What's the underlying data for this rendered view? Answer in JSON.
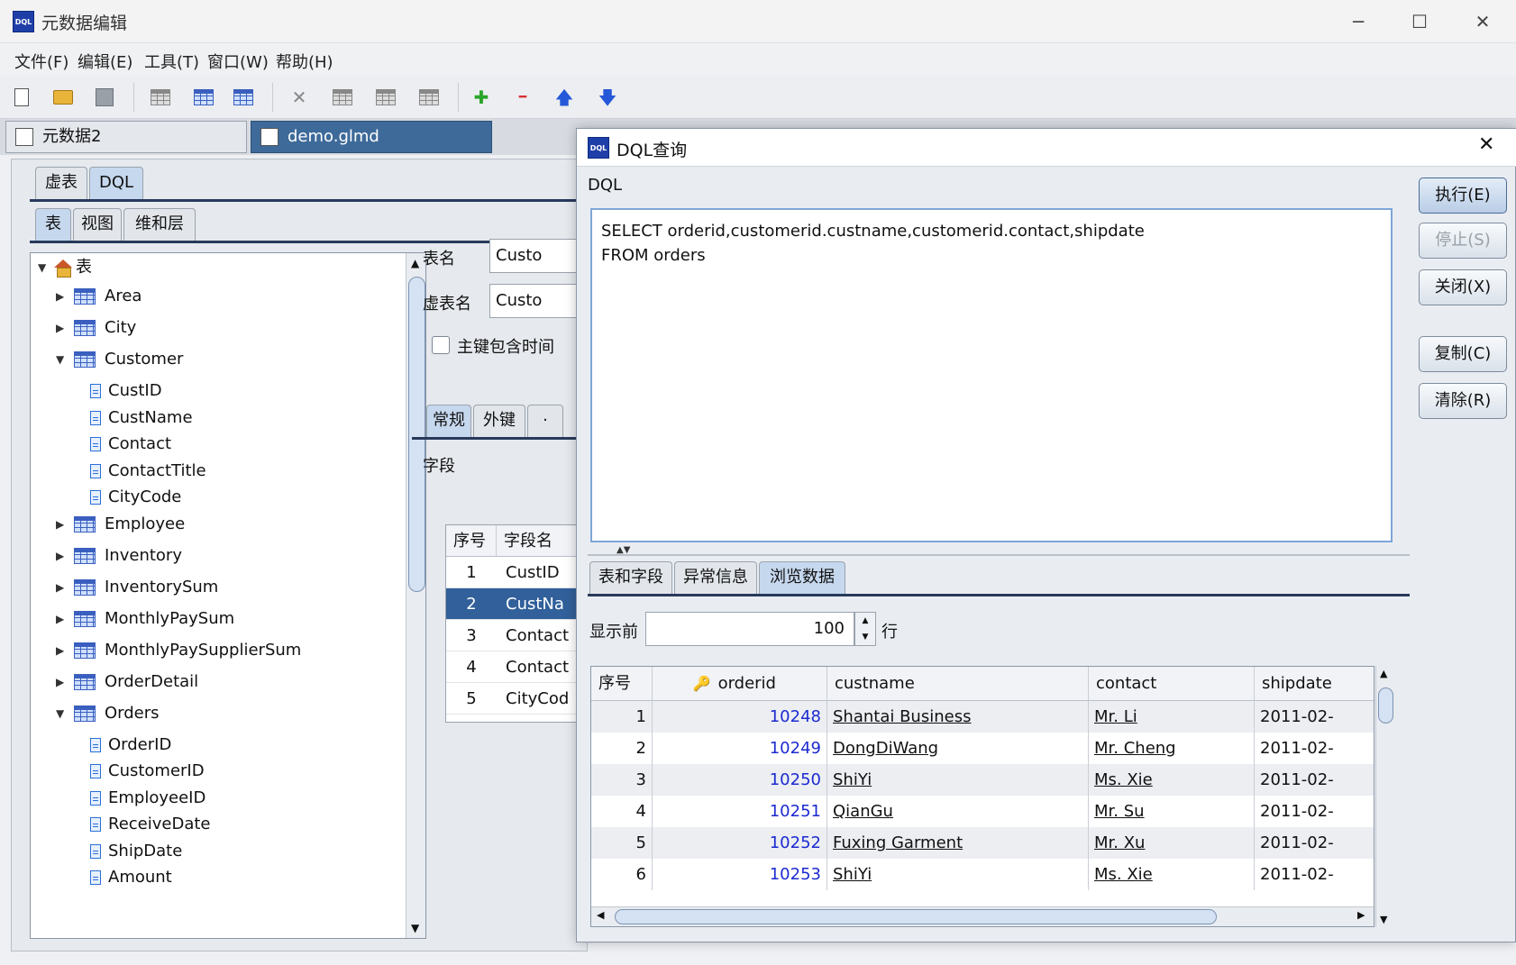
{
  "window": {
    "title": "元数据编辑",
    "app_icon": "DQL",
    "controls": {
      "minimize": "─",
      "maximize": "☐",
      "close": "✕"
    }
  },
  "menu": [
    "文件(F)",
    "编辑(E)",
    "工具(T)",
    "窗口(W)",
    "帮助(H)"
  ],
  "toolbar_icons": [
    "new-icon",
    "open-folder-icon",
    "save-icon",
    "table-icon",
    "add-table-icon",
    "add-table-2-icon",
    "delete-icon",
    "copy-icon",
    "table-gray-icon",
    "table-gray-2-icon",
    "add-icon",
    "remove-icon",
    "move-up-icon",
    "move-down-icon"
  ],
  "toolbar_glyphs": {
    "delete": "✕",
    "add": "✚",
    "remove": "━",
    "up": "🡅",
    "down": "🡇"
  },
  "doc_tabs": [
    "元数据2",
    "demo.glmd"
  ],
  "editor": {
    "top_tabs": [
      "虚表",
      "DQL"
    ],
    "sub_tabs": [
      "表",
      "视图",
      "维和层"
    ],
    "tree_root": "表",
    "tree": [
      {
        "kind": "table",
        "label": "Area",
        "expanded": false
      },
      {
        "kind": "table",
        "label": "City",
        "expanded": false
      },
      {
        "kind": "table",
        "label": "Customer",
        "expanded": true
      },
      {
        "kind": "field",
        "label": "CustID"
      },
      {
        "kind": "field",
        "label": "CustName"
      },
      {
        "kind": "field",
        "label": "Contact"
      },
      {
        "kind": "field",
        "label": "ContactTitle"
      },
      {
        "kind": "field",
        "label": "CityCode"
      },
      {
        "kind": "table",
        "label": "Employee",
        "expanded": false
      },
      {
        "kind": "table",
        "label": "Inventory",
        "expanded": false
      },
      {
        "kind": "table",
        "label": "InventorySum",
        "expanded": false
      },
      {
        "kind": "table",
        "label": "MonthlyPaySum",
        "expanded": false
      },
      {
        "kind": "table",
        "label": "MonthlyPaySupplierSum",
        "expanded": false
      },
      {
        "kind": "table",
        "label": "OrderDetail",
        "expanded": false
      },
      {
        "kind": "table",
        "label": "Orders",
        "expanded": true
      },
      {
        "kind": "field",
        "label": "OrderID"
      },
      {
        "kind": "field",
        "label": "CustomerID"
      },
      {
        "kind": "field",
        "label": "EmployeeID"
      },
      {
        "kind": "field",
        "label": "ReceiveDate"
      },
      {
        "kind": "field",
        "label": "ShipDate"
      },
      {
        "kind": "field",
        "label": "Amount"
      }
    ],
    "form": {
      "table_name_label": "表名",
      "table_name_value": "Custo",
      "virtual_name_label": "虚表名",
      "virtual_name_value": "Custo",
      "pk_time_label": "主键包含时间",
      "detail_tabs": [
        "常规",
        "外键",
        "·"
      ],
      "fields_label": "字段",
      "fields_headers": [
        "序号",
        "字段名"
      ],
      "fields_rows": [
        {
          "n": "1",
          "name": "CustID"
        },
        {
          "n": "2",
          "name": "CustNa"
        },
        {
          "n": "3",
          "name": "Contact"
        },
        {
          "n": "4",
          "name": "Contact"
        },
        {
          "n": "5",
          "name": "CityCod"
        }
      ],
      "selected_row": 1
    }
  },
  "dialog": {
    "title": "DQL查询",
    "section_label": "DQL",
    "sql_lines": [
      "SELECT orderid,customerid.custname,customerid.contact,shipdate",
      "FROM orders"
    ],
    "buttons": {
      "execute": "执行(E)",
      "stop": "停止(S)",
      "close": "关闭(X)",
      "copy": "复制(C)",
      "clear": "清除(R)"
    },
    "tabs": [
      "表和字段",
      "异常信息",
      "浏览数据"
    ],
    "selected_tab": 2,
    "show_first_label": "显示前",
    "show_first_value": "100",
    "rows_label": "行",
    "columns": [
      "序号",
      "orderid",
      "custname",
      "contact",
      "shipdate"
    ],
    "rows": [
      {
        "seq": "1",
        "orderid": "10248",
        "custname": "Shantai Business",
        "contact": "Mr. Li",
        "shipdate": "2011-02-"
      },
      {
        "seq": "2",
        "orderid": "10249",
        "custname": "DongDiWang",
        "contact": "Mr. Cheng",
        "shipdate": "2011-02-"
      },
      {
        "seq": "3",
        "orderid": "10250",
        "custname": "ShiYi",
        "contact": "Ms. Xie",
        "shipdate": "2011-02-"
      },
      {
        "seq": "4",
        "orderid": "10251",
        "custname": "QianGu",
        "contact": "Mr. Su",
        "shipdate": "2011-02-"
      },
      {
        "seq": "5",
        "orderid": "10252",
        "custname": "Fuxing Garment",
        "contact": "Mr. Xu",
        "shipdate": "2011-02-"
      },
      {
        "seq": "6",
        "orderid": "10253",
        "custname": "ShiYi",
        "contact": "Ms. Xie",
        "shipdate": "2011-02-"
      }
    ]
  },
  "colors": {
    "accent": "#3e6a9a",
    "link_number": "#1c2ad0",
    "selection": "#31609a"
  }
}
